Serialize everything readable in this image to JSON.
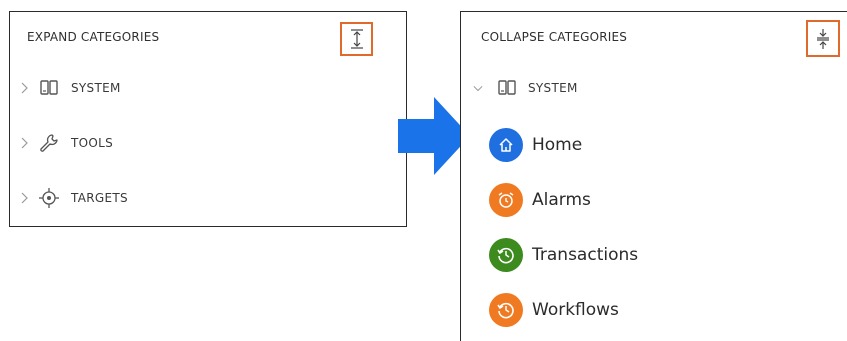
{
  "left_panel": {
    "title": "EXPAND CATEGORIES",
    "expand_button_icon": "expand-vertical-icon",
    "categories": [
      {
        "label": "SYSTEM",
        "icon": "device-icon"
      },
      {
        "label": "TOOLS",
        "icon": "wrench-icon"
      },
      {
        "label": "TARGETS",
        "icon": "target-icon"
      }
    ]
  },
  "right_panel": {
    "title": "COLLAPSE CATEGORIES",
    "collapse_button_icon": "collapse-vertical-icon",
    "category": {
      "label": "SYSTEM",
      "icon": "device-icon"
    },
    "items": [
      {
        "label": "Home",
        "icon": "home-icon",
        "color": "#1f6fe0"
      },
      {
        "label": "Alarms",
        "icon": "alarm-clock-icon",
        "color": "#ef7a22"
      },
      {
        "label": "Transactions",
        "icon": "history-icon",
        "color": "#3d8a1f"
      },
      {
        "label": "Workflows",
        "icon": "history-icon",
        "color": "#ef7a22"
      }
    ]
  },
  "colors": {
    "highlight_border": "#e06a2c",
    "arrow": "#1a73e8",
    "panel_border": "#2b2b2b"
  }
}
